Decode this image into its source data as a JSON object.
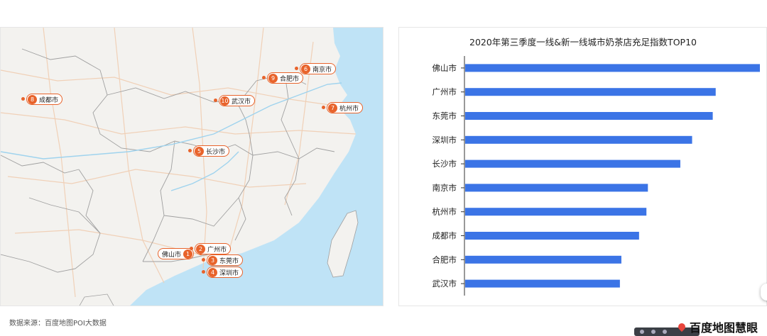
{
  "map": {
    "markers": [
      {
        "rank": "1",
        "city": "佛山市",
        "dir": "left"
      },
      {
        "rank": "2",
        "city": "广州市",
        "dir": "right"
      },
      {
        "rank": "3",
        "city": "东莞市",
        "dir": "right"
      },
      {
        "rank": "4",
        "city": "深圳市",
        "dir": "right"
      },
      {
        "rank": "5",
        "city": "长沙市",
        "dir": "right"
      },
      {
        "rank": "6",
        "city": "南京市",
        "dir": "right"
      },
      {
        "rank": "7",
        "city": "杭州市",
        "dir": "right"
      },
      {
        "rank": "8",
        "city": "成都市",
        "dir": "right"
      },
      {
        "rank": "9",
        "city": "合肥市",
        "dir": "right"
      },
      {
        "rank": "10",
        "city": "武汉市",
        "dir": "right"
      }
    ],
    "colors": {
      "land": "#f3f2ef",
      "sea": "#bfe3f6",
      "border": "#a0a0a0",
      "road": "#f3d9c3",
      "marker": "#e8632b"
    }
  },
  "source_note": "数据来源：百度地图POI大数据",
  "chart_data": {
    "type": "bar",
    "orientation": "horizontal",
    "title": "2020年第三季度一线&新一线城市奶茶店充足指数TOP10",
    "categories": [
      "佛山市",
      "广州市",
      "东莞市",
      "深圳市",
      "长沙市",
      "南京市",
      "杭州市",
      "成都市",
      "合肥市",
      "武汉市"
    ],
    "values": [
      100,
      85,
      84,
      77,
      73,
      62,
      61.5,
      59,
      53,
      52.5
    ],
    "xlim": [
      0,
      100
    ],
    "bar_color": "#3b74e6",
    "grid": false,
    "legend": "none"
  },
  "brand": {
    "name": "百度地图慧眼"
  }
}
